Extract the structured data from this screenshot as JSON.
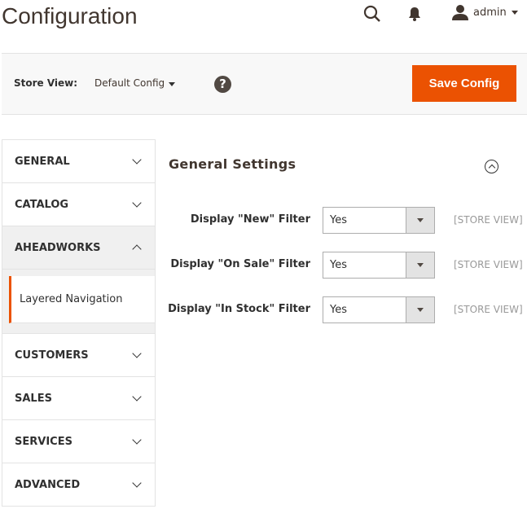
{
  "header": {
    "title": "Configuration",
    "user": "admin"
  },
  "toolbar": {
    "store_view_label": "Store View:",
    "store_view_value": "Default Config",
    "save_label": "Save Config"
  },
  "sidebar": {
    "items": [
      {
        "label": "GENERAL"
      },
      {
        "label": "CATALOG"
      },
      {
        "label": "AHEADWORKS",
        "open": true,
        "sub": [
          {
            "label": "Layered Navigation",
            "active": true
          }
        ]
      },
      {
        "label": "CUSTOMERS"
      },
      {
        "label": "SALES"
      },
      {
        "label": "SERVICES"
      },
      {
        "label": "ADVANCED"
      }
    ]
  },
  "section": {
    "title": "General Settings",
    "fields": [
      {
        "label": "Display \"New\" Filter",
        "value": "Yes",
        "scope": "[STORE VIEW]"
      },
      {
        "label": "Display \"On Sale\" Filter",
        "value": "Yes",
        "scope": "[STORE VIEW]"
      },
      {
        "label": "Display \"In Stock\" Filter",
        "value": "Yes",
        "scope": "[STORE VIEW]"
      }
    ]
  },
  "colors": {
    "accent": "#eb5202"
  }
}
